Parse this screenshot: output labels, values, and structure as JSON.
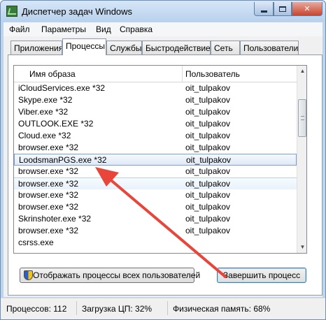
{
  "window": {
    "title": "Диспетчер задач Windows",
    "accent_close": "#c8452f"
  },
  "menu": [
    "Файл",
    "Параметры",
    "Вид",
    "Справка"
  ],
  "tabs": [
    {
      "label": "Приложения",
      "active": false
    },
    {
      "label": "Процессы",
      "active": true
    },
    {
      "label": "Службы",
      "active": false
    },
    {
      "label": "Быстродействие",
      "active": false
    },
    {
      "label": "Сеть",
      "active": false
    },
    {
      "label": "Пользователи",
      "active": false
    }
  ],
  "process_list": {
    "columns": [
      "Имя образа",
      "Пользователь"
    ],
    "rows": [
      {
        "image": "iCloudServices.exe *32",
        "user": "oit_tulpakov"
      },
      {
        "image": "Skype.exe *32",
        "user": "oit_tulpakov"
      },
      {
        "image": "Viber.exe *32",
        "user": "oit_tulpakov"
      },
      {
        "image": "OUTLOOK.EXE *32",
        "user": "oit_tulpakov"
      },
      {
        "image": "Cloud.exe *32",
        "user": "oit_tulpakov"
      },
      {
        "image": "browser.exe *32",
        "user": "oit_tulpakov"
      },
      {
        "image": "LoodsmanPGS.exe *32",
        "user": "oit_tulpakov",
        "selected": true
      },
      {
        "image": "browser.exe *32",
        "user": "oit_tulpakov"
      },
      {
        "image": "browser.exe *32",
        "user": "oit_tulpakov",
        "highlighted": true
      },
      {
        "image": "browser.exe *32",
        "user": "oit_tulpakov"
      },
      {
        "image": "browser.exe *32",
        "user": "oit_tulpakov"
      },
      {
        "image": "Skrinshoter.exe *32",
        "user": "oit_tulpakov"
      },
      {
        "image": "browser.exe *32",
        "user": "oit_tulpakov"
      },
      {
        "image": "csrss.exe",
        "user": ""
      }
    ]
  },
  "buttons": {
    "show_all_processes": "Отображать процессы всех пользователей",
    "end_process": "Завершить процесс"
  },
  "annotation": {
    "arrow_color": "#e8463a"
  },
  "status": {
    "processes": "Процессов: 112",
    "cpu": "Загрузка ЦП: 32%",
    "memory": "Физическая память: 68%"
  }
}
